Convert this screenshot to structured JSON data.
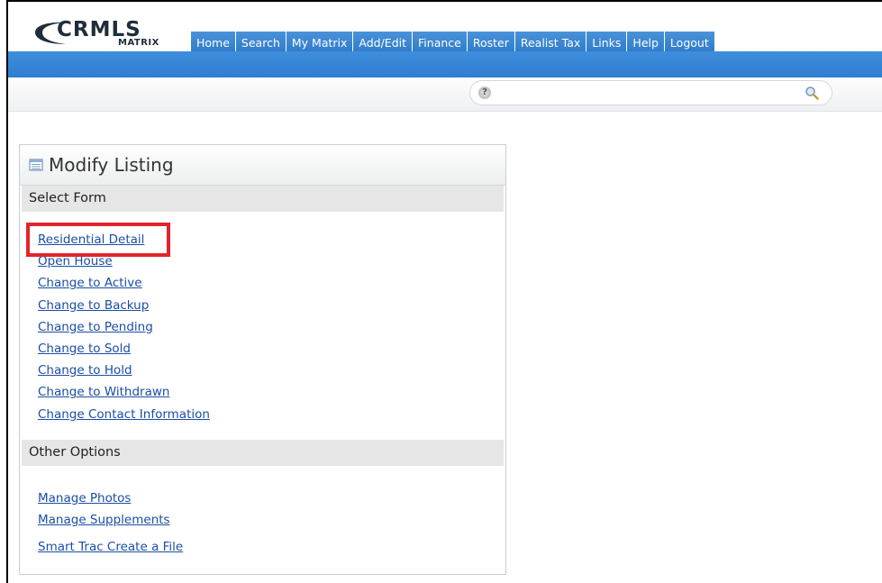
{
  "logo": {
    "main": "CRMLS",
    "sub": "MATRIX"
  },
  "nav": {
    "tabs": [
      "Home",
      "Search",
      "My Matrix",
      "Add/Edit",
      "Finance",
      "Roster",
      "Realist Tax",
      "Links",
      "Help",
      "Logout"
    ]
  },
  "search": {
    "value": "",
    "help_glyph": "?"
  },
  "panel": {
    "title": "Modify Listing",
    "select_form_header": "Select Form",
    "select_form_links": [
      "Residential Detail",
      "Open House",
      "Change to Active",
      "Change to Backup",
      "Change to Pending",
      "Change to Sold",
      "Change to Hold",
      "Change to Withdrawn",
      "Change Contact Information"
    ],
    "other_options_header": "Other Options",
    "other_options_links": [
      "Manage Photos",
      "Manage Supplements",
      "Smart Trac Create a File"
    ]
  },
  "colors": {
    "nav_blue": "#2d79c8",
    "link_blue": "#1a4ea6",
    "highlight_red": "#e3232b"
  }
}
